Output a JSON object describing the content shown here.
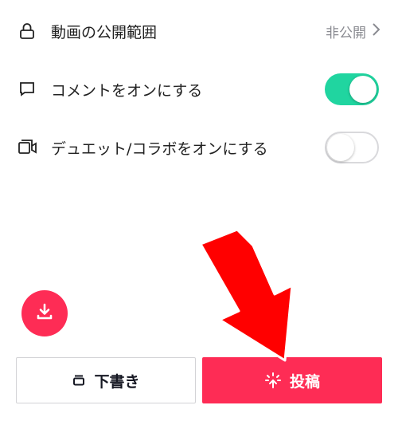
{
  "settings": {
    "privacy": {
      "label": "動画の公開範囲",
      "value": "非公開",
      "icon": "lock-icon"
    },
    "comments": {
      "label": "コメントをオンにする",
      "enabled": true,
      "icon": "comment-icon"
    },
    "duet": {
      "label": "デュエット/コラボをオンにする",
      "enabled": false,
      "icon": "duet-icon"
    }
  },
  "actions": {
    "download_icon": "download-icon",
    "draft_label": "下書き",
    "post_label": "投稿"
  },
  "colors": {
    "accent": "#fe2c55",
    "toggle_on": "#20d5a0",
    "annotation_arrow": "#ff0000"
  }
}
